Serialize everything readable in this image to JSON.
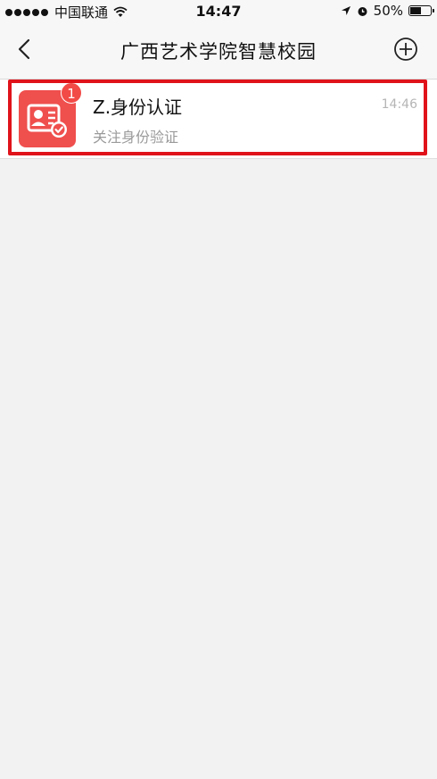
{
  "status_bar": {
    "carrier": "中国联通",
    "time": "14:47",
    "battery_percent": "50%"
  },
  "nav": {
    "title": "广西艺术学院智慧校园"
  },
  "conversations": [
    {
      "title": "Z.身份认证",
      "subtitle": "关注身份验证",
      "time": "14:46",
      "badge": "1",
      "icon": "id-card-verified-icon",
      "icon_color": "#ef4f4d"
    }
  ],
  "colors": {
    "highlight": "#e0131b",
    "badge": "#f24a46"
  }
}
